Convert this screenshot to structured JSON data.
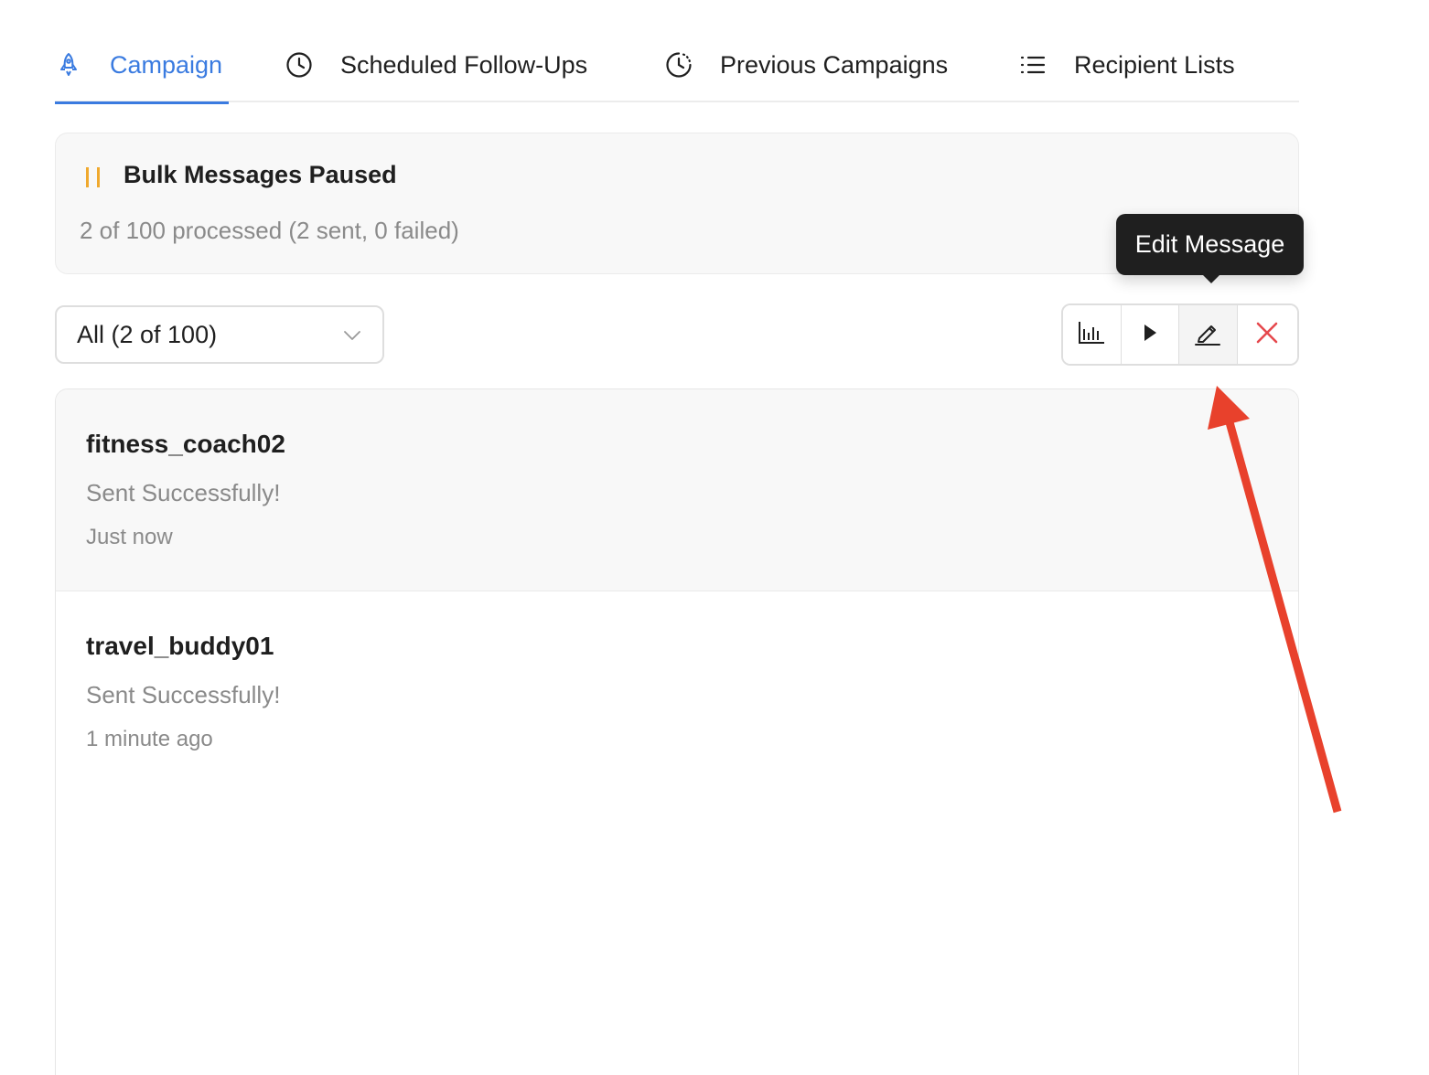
{
  "tabs": [
    {
      "label": "Campaign",
      "icon": "rocket-icon",
      "active": true
    },
    {
      "label": "Scheduled Follow-Ups",
      "icon": "clock-icon",
      "active": false
    },
    {
      "label": "Previous Campaigns",
      "icon": "history-icon",
      "active": false
    },
    {
      "label": "Recipient Lists",
      "icon": "list-icon",
      "active": false
    }
  ],
  "status": {
    "title": "Bulk Messages Paused",
    "progress_text": "2 of 100 processed (2 sent, 0 failed)",
    "icon": "pause-icon",
    "icon_color": "#f0a92e"
  },
  "filter": {
    "selected": "All (2 of 100)"
  },
  "toolbar": {
    "buttons": [
      {
        "icon": "bar-chart-icon"
      },
      {
        "icon": "play-icon"
      },
      {
        "icon": "edit-pencil-icon"
      },
      {
        "icon": "close-icon",
        "color": "#e5484d"
      }
    ]
  },
  "tooltip": {
    "text": "Edit Message"
  },
  "messages": [
    {
      "user": "fitness_coach02",
      "status": "Sent Successfully!",
      "time": "Just now"
    },
    {
      "user": "travel_buddy01",
      "status": "Sent Successfully!",
      "time": "1 minute ago"
    }
  ],
  "colors": {
    "accent": "#3a7be0",
    "annotation_arrow": "#e8412c"
  }
}
